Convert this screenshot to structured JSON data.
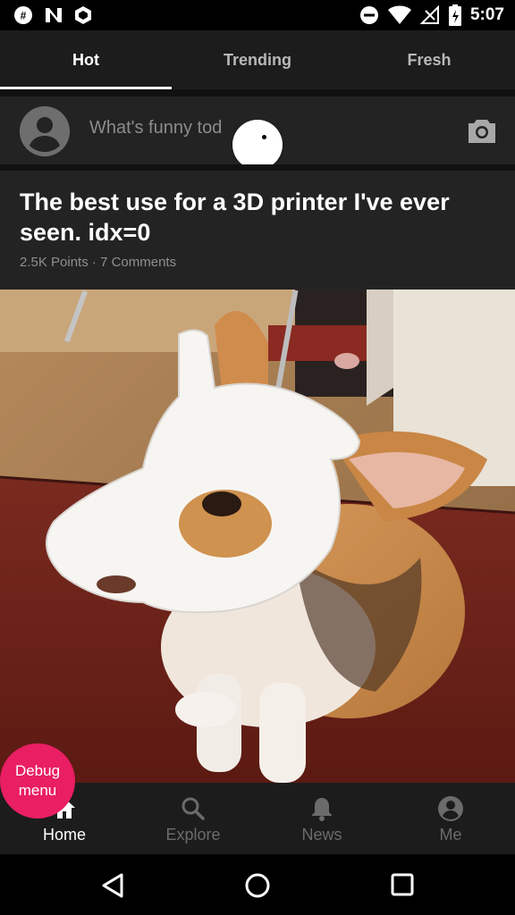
{
  "status_bar": {
    "time": "5:07"
  },
  "tabs": [
    {
      "label": "Hot",
      "active": true
    },
    {
      "label": "Trending",
      "active": false
    },
    {
      "label": "Fresh",
      "active": false
    }
  ],
  "composer": {
    "placeholder": "What's funny tod"
  },
  "post": {
    "title": "The best use for a 3D printer I've ever seen. idx=0",
    "points": "2.5K Points",
    "separator": "·",
    "comments": "7 Comments"
  },
  "debug_button": {
    "label": "Debug menu"
  },
  "bottom_nav": [
    {
      "label": "Home",
      "icon": "home-icon",
      "active": true
    },
    {
      "label": "Explore",
      "icon": "search-icon",
      "active": false
    },
    {
      "label": "News",
      "icon": "bell-icon",
      "active": false
    },
    {
      "label": "Me",
      "icon": "account-icon",
      "active": false
    }
  ],
  "colors": {
    "accent_debug": "#e91e63",
    "tab_bar": "#1c1c1c",
    "card": "#232323",
    "inactive_text": "#6b6b6b"
  }
}
